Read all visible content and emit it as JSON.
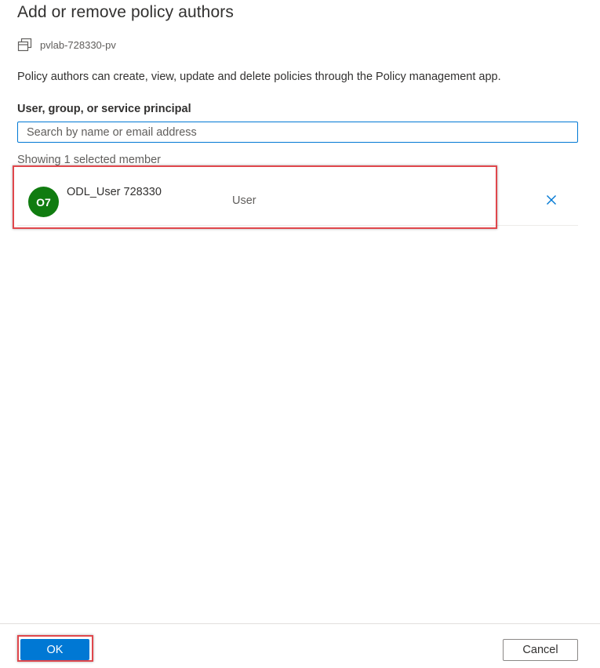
{
  "dialog": {
    "title": "Add or remove policy authors",
    "resource_name": "pvlab-728330-pv",
    "resource_icon": "collection-icon",
    "description": "Policy authors can create, view, update and delete policies through the Policy management app."
  },
  "search": {
    "label": "User, group, or service principal",
    "placeholder": "Search by name or email address",
    "value": ""
  },
  "selection": {
    "summary": "Showing 1 selected member",
    "members": [
      {
        "initials": "O7",
        "name": "ODL_User 728330",
        "type": "User",
        "avatar_color": "#107c10"
      }
    ]
  },
  "footer": {
    "ok_label": "OK",
    "cancel_label": "Cancel"
  },
  "colors": {
    "accent": "#0078d4",
    "highlight": "#e0474c"
  }
}
